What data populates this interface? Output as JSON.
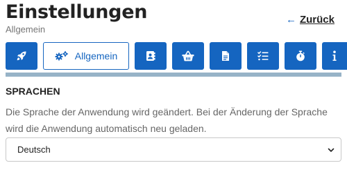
{
  "header": {
    "title": "Einstellungen",
    "subtitle": "Allgemein",
    "back_label": "Zurück",
    "back_icon": "arrow-left-icon"
  },
  "tabs": [
    {
      "icon": "rocket-icon",
      "label": ""
    },
    {
      "icon": "gears-icon",
      "label": "Allgemein",
      "active": true
    },
    {
      "icon": "address-book-icon",
      "label": ""
    },
    {
      "icon": "basket-icon",
      "label": ""
    },
    {
      "icon": "document-icon",
      "label": ""
    },
    {
      "icon": "checklist-icon",
      "label": ""
    },
    {
      "icon": "stopwatch-icon",
      "label": ""
    },
    {
      "icon": "info-icon",
      "label": ""
    }
  ],
  "section": {
    "heading": "SPRACHEN",
    "description": "Die Sprache der Anwendung wird geändert. Bei der Änderung der Sprache wird die Anwendung automatisch neu geladen.",
    "language_select": {
      "selected": "Deutsch"
    }
  },
  "colors": {
    "accent": "#1565c0",
    "divider": "#97b3c7",
    "muted_text": "#666666"
  }
}
